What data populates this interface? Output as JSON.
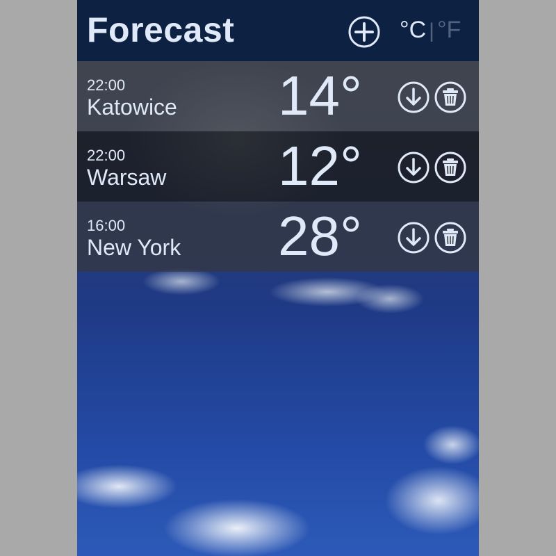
{
  "header": {
    "title": "Forecast",
    "units": {
      "celsius": "°C",
      "separator": "|",
      "fahrenheit": "°F",
      "active": "celsius"
    }
  },
  "cities": [
    {
      "time": "22:00",
      "name": "Katowice",
      "temp": "14°"
    },
    {
      "time": "22:00",
      "name": "Warsaw",
      "temp": "12°"
    },
    {
      "time": "16:00",
      "name": "New York",
      "temp": "28°"
    }
  ],
  "icons": {
    "add": "plus-circle-icon",
    "download": "arrow-down-circle-icon",
    "delete": "trash-circle-icon"
  },
  "colors": {
    "header_bg": "#0d2143",
    "text": "#dfe9f8",
    "inactive_text": "#52627f"
  }
}
